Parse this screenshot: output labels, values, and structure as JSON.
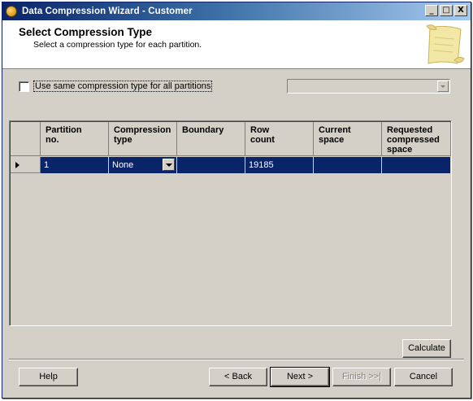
{
  "window": {
    "title": "Data Compression Wizard - Customer",
    "minimize_glyph": "_",
    "maximize_glyph": "□",
    "close_glyph": "X"
  },
  "header": {
    "heading": "Select Compression Type",
    "subheading": "Select a compression type for each partition."
  },
  "option": {
    "checked": false,
    "label": "Use same compression type for all partitions",
    "combo_value": ""
  },
  "grid": {
    "columns": [
      "Partition\nno.",
      "Compression\ntype",
      "Boundary",
      "Row\ncount",
      "Current\nspace",
      "Requested\ncompressed\nspace"
    ],
    "rows": [
      {
        "partition_no": "1",
        "compression_type": "None",
        "boundary": "",
        "row_count": "19185",
        "current_space": "",
        "requested_space": ""
      }
    ]
  },
  "buttons": {
    "calculate": "Calculate",
    "help": "Help",
    "back": "< Back",
    "next": "Next >",
    "finish": "Finish >>|",
    "cancel": "Cancel"
  },
  "colors": {
    "selection": "#0a246a",
    "face": "#d4d0c8"
  },
  "icons": {
    "app": "app-icon",
    "banner": "scroll-icon",
    "row_pointer": "row-pointer-icon",
    "dropdown": "chevron-down-icon"
  }
}
